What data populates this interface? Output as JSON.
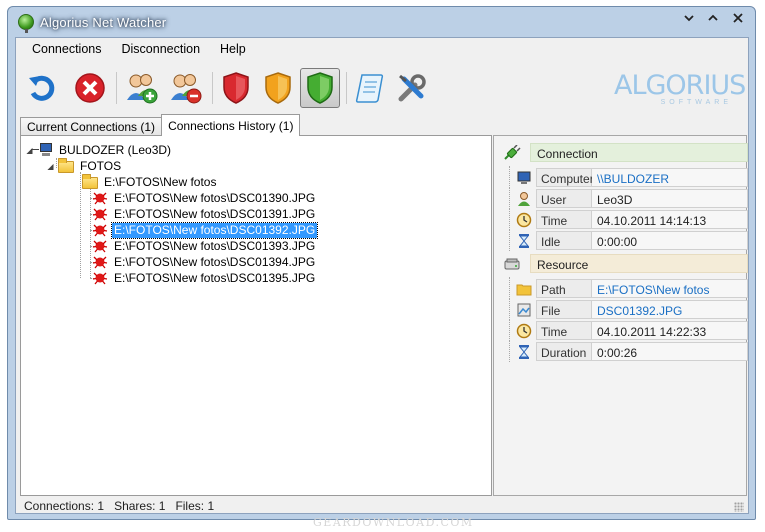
{
  "window": {
    "title": "Algorius Net Watcher"
  },
  "menu": {
    "items": [
      "Connections",
      "Disconnection",
      "Help"
    ]
  },
  "brand": {
    "name": "ALGORIUS",
    "sub": "SOFTWARE",
    "color": "#9cc6e8"
  },
  "toolbar": {
    "buttons": [
      {
        "name": "refresh-button",
        "icon": "refresh-icon"
      },
      {
        "name": "close-connection-button",
        "icon": "red-x-icon"
      },
      {
        "name": "add-user-button",
        "icon": "users-add-icon"
      },
      {
        "name": "remove-user-button",
        "icon": "users-remove-icon"
      },
      {
        "name": "shield-red-button",
        "icon": "shield-red-icon"
      },
      {
        "name": "shield-orange-button",
        "icon": "shield-orange-icon"
      },
      {
        "name": "shield-green-button",
        "icon": "shield-green-icon",
        "active": true
      },
      {
        "name": "log-button",
        "icon": "scroll-icon"
      },
      {
        "name": "settings-button",
        "icon": "tools-icon"
      }
    ]
  },
  "tabs": [
    {
      "label": "Current Connections (1)",
      "active": false
    },
    {
      "label": "Connections History (1)",
      "active": true
    }
  ],
  "tree": {
    "computer": "BULDOZER (Leo3D)",
    "share": "FOTOS",
    "folder": "E:\\FOTOS\\New fotos",
    "files": [
      {
        "label": "E:\\FOTOS\\New fotos\\DSC01390.JPG",
        "selected": false
      },
      {
        "label": "E:\\FOTOS\\New fotos\\DSC01391.JPG",
        "selected": false
      },
      {
        "label": "E:\\FOTOS\\New fotos\\DSC01392.JPG",
        "selected": true
      },
      {
        "label": "E:\\FOTOS\\New fotos\\DSC01393.JPG",
        "selected": false
      },
      {
        "label": "E:\\FOTOS\\New fotos\\DSC01394.JPG",
        "selected": false
      },
      {
        "label": "E:\\FOTOS\\New fotos\\DSC01395.JPG",
        "selected": false
      }
    ]
  },
  "properties": {
    "connection": {
      "header": "Connection",
      "rows": [
        {
          "key": "Computer",
          "value": "\\\\BULDOZER",
          "link": true,
          "icon": "computer-icon"
        },
        {
          "key": "User",
          "value": "Leo3D",
          "link": false,
          "icon": "user-icon"
        },
        {
          "key": "Time",
          "value": "04.10.2011 14:14:13",
          "link": false,
          "icon": "clock-icon"
        },
        {
          "key": "Idle",
          "value": "0:00:00",
          "link": false,
          "icon": "hourglass-icon"
        }
      ]
    },
    "resource": {
      "header": "Resource",
      "rows": [
        {
          "key": "Path",
          "value": "E:\\FOTOS\\New fotos",
          "link": true,
          "icon": "folder-icon"
        },
        {
          "key": "File",
          "value": "DSC01392.JPG",
          "link": true,
          "icon": "file-icon"
        },
        {
          "key": "Time",
          "value": "04.10.2011 14:22:33",
          "link": false,
          "icon": "clock-icon"
        },
        {
          "key": "Duration",
          "value": "0:00:26",
          "link": false,
          "icon": "hourglass-icon"
        }
      ]
    }
  },
  "status": {
    "connections": "Connections: 1",
    "shares": "Shares: 1",
    "files": "Files: 1"
  },
  "watermark": "GEARDOWNLOAD.COM"
}
